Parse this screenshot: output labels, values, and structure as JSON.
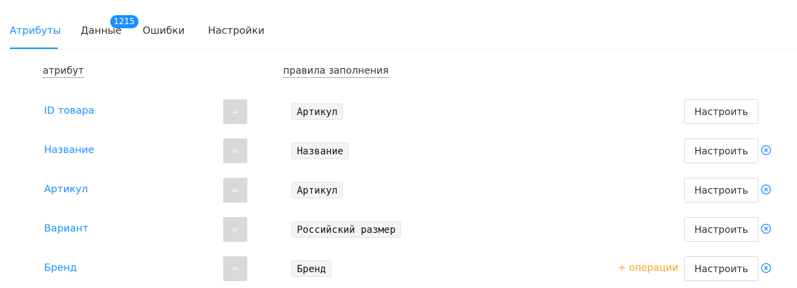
{
  "tabs": {
    "attributes": "Атрибуты",
    "data": "Данные",
    "data_badge": "1215",
    "errors": "Ошибки",
    "settings": "Настройки"
  },
  "headers": {
    "attribute": "атрибут",
    "rules": "правила заполнения"
  },
  "equals_label": "=",
  "configure_label": "Настроить",
  "operations_label": "+ операции",
  "rows": [
    {
      "name": "ID товара",
      "rule": "Артикул"
    },
    {
      "name": "Название",
      "rule": "Название"
    },
    {
      "name": "Артикул",
      "rule": "Артикул"
    },
    {
      "name": "Вариант",
      "rule": "Российский размер"
    },
    {
      "name": "Бренд",
      "rule": "Бренд"
    }
  ],
  "colors": {
    "accent": "#1890ff",
    "operations": "#f5a623",
    "equals_bg": "#d9d9d9"
  }
}
